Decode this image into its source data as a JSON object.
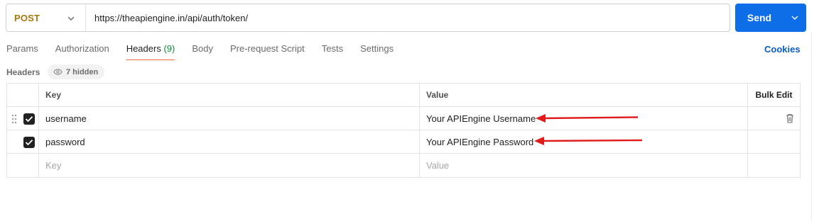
{
  "request": {
    "method": "POST",
    "url": "https://theapiengine.in/api/auth/token/",
    "send_label": "Send"
  },
  "tabs": [
    {
      "label": "Params"
    },
    {
      "label": "Authorization"
    },
    {
      "label": "Headers",
      "count": "(9)",
      "active": true
    },
    {
      "label": "Body"
    },
    {
      "label": "Pre-request Script"
    },
    {
      "label": "Tests"
    },
    {
      "label": "Settings"
    }
  ],
  "cookies_label": "Cookies",
  "headers_section": {
    "title": "Headers",
    "hidden_label": "7 hidden"
  },
  "table": {
    "columns": {
      "key": "Key",
      "value": "Value",
      "bulk_edit": "Bulk Edit"
    },
    "rows": [
      {
        "key": "username",
        "value": "Your APIEngine Username",
        "checked": true
      },
      {
        "key": "password",
        "value": "Your APIEngine Password",
        "checked": true
      }
    ],
    "placeholder": {
      "key": "Key",
      "value": "Value"
    }
  },
  "colors": {
    "method": "#a8780b",
    "send": "#0d6ee8",
    "active_tab_underline": "#f26b3a",
    "tab_count": "#0a8a3c",
    "cookies": "#0a5cc7",
    "annotation_arrow": "#e01b1b"
  },
  "icons": {
    "method_dropdown": "chevron-down-icon",
    "send_dropdown": "chevron-down-icon",
    "hidden": "eye-icon",
    "drag": "drag-handle-icon",
    "check": "checkmark-icon",
    "delete": "trash-icon",
    "annotation": "red-arrow-icon"
  }
}
